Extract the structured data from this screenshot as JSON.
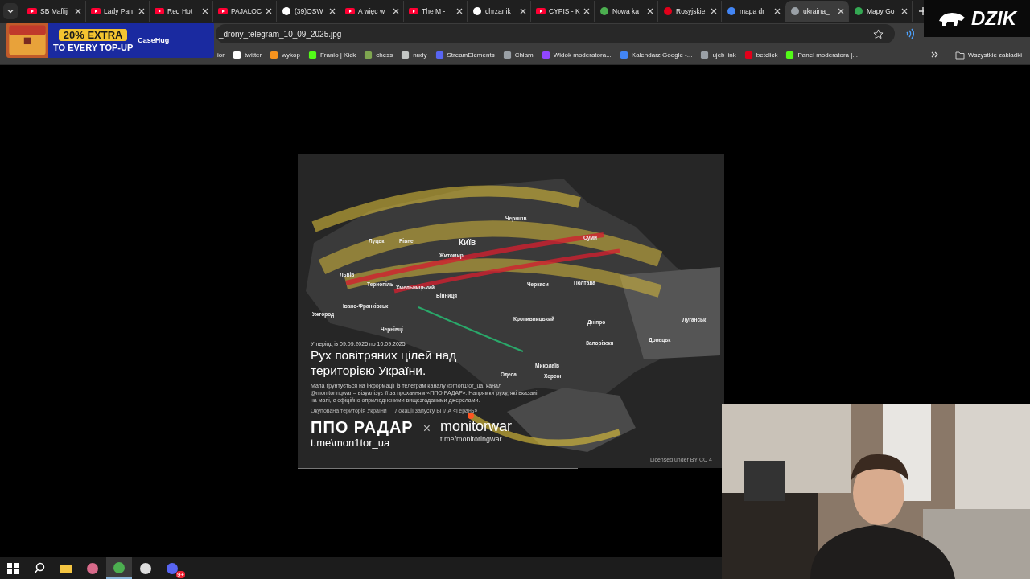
{
  "tabs": [
    {
      "label": "SB Maffij",
      "kind": "youtube",
      "selected": false
    },
    {
      "label": "Lady Pan",
      "kind": "youtube",
      "selected": false
    },
    {
      "label": "Red Hot",
      "kind": "youtube",
      "selected": false
    },
    {
      "label": "PAJALOC",
      "kind": "youtube",
      "selected": false
    },
    {
      "label": "(39)OSW",
      "kind": "tiktok",
      "selected": false
    },
    {
      "label": "A więc w",
      "kind": "youtube",
      "selected": false
    },
    {
      "label": "The M -",
      "kind": "youtube",
      "selected": false
    },
    {
      "label": "chrzanik",
      "kind": "x",
      "selected": false
    },
    {
      "label": "CYPIS - K",
      "kind": "youtube",
      "selected": false
    },
    {
      "label": "Nowa ka",
      "kind": "chrome",
      "selected": false
    },
    {
      "label": "Rosyjskie",
      "kind": "wp",
      "selected": false
    },
    {
      "label": "mapa dr",
      "kind": "google",
      "selected": false
    },
    {
      "label": "ukraina_",
      "kind": "globe",
      "selected": true
    },
    {
      "label": "Mapy Go",
      "kind": "maps",
      "selected": false
    }
  ],
  "address": "_drony_telegram_10_09_2025.jpg",
  "bookmarks": [
    {
      "label": "ior",
      "kind": "none"
    },
    {
      "label": "twitter",
      "kind": "x"
    },
    {
      "label": "wykop",
      "kind": "wykop"
    },
    {
      "label": "Franio | Kick",
      "kind": "kick"
    },
    {
      "label": "chess",
      "kind": "pawn"
    },
    {
      "label": "nudy",
      "kind": "folder"
    },
    {
      "label": "StreamElements",
      "kind": "se"
    },
    {
      "label": "Chłam",
      "kind": "globe"
    },
    {
      "label": "Widok moderatora...",
      "kind": "twitch"
    },
    {
      "label": "Kalendarz Google -...",
      "kind": "calendar"
    },
    {
      "label": "ujeb link",
      "kind": "globe"
    },
    {
      "label": "betclick",
      "kind": "bet"
    },
    {
      "label": "Panel moderatora |...",
      "kind": "kick"
    }
  ],
  "all_bookmarks": "Wszystkie zakładki",
  "ad": {
    "headline": "20% EXTRA",
    "subline": "TO EVERY TOP-UP",
    "brand": "CaseHug"
  },
  "stream_logo": "DZIK",
  "map": {
    "cities": [
      "Чернігів",
      "Луцьк",
      "Рівне",
      "Київ",
      "Суми",
      "Житомир",
      "Львів",
      "Тернопіль",
      "Хмельницький",
      "Черкаси",
      "Полтава",
      "Вінниця",
      "Івано-Франківськ",
      "Ужгород",
      "Кропивницький",
      "Дніпро",
      "Луганськ",
      "Чернівці",
      "Запоріжжя",
      "Донецьк",
      "Миколаїв",
      "Одеса",
      "Херсон"
    ],
    "period": "У період із 09.09.2025 по 10.09.2025",
    "title": "Рух повітряних цілей над територією України.",
    "description": "Мапа ґрунтується на інформації із телеграм каналу @mon1tor_ua, канал @monitoringwar – візуалізує її за проханням «ППО РАДАР». Напрямки руху, які вказані на мапі, є офіційно оприлюдненими вищезгаданими джерелами.",
    "legend": [
      "Окупована територія України",
      "Локації запуску БПЛА «Герань»"
    ],
    "brand": "ППО РАДАР",
    "brand_link": "t.me\\mon1tor_ua",
    "separator": "×",
    "partner": "monitorwar",
    "partner_link": "t.me/monitoringwar",
    "license": "Licensed under BY CC 4"
  },
  "taskbar": [
    {
      "kind": "windows",
      "selected": false
    },
    {
      "kind": "search",
      "selected": false
    },
    {
      "kind": "folder",
      "selected": false
    },
    {
      "kind": "app",
      "selected": false
    },
    {
      "kind": "chrome",
      "selected": true
    },
    {
      "kind": "obs",
      "selected": false
    },
    {
      "kind": "discord",
      "selected": false,
      "badge": "9+"
    }
  ]
}
